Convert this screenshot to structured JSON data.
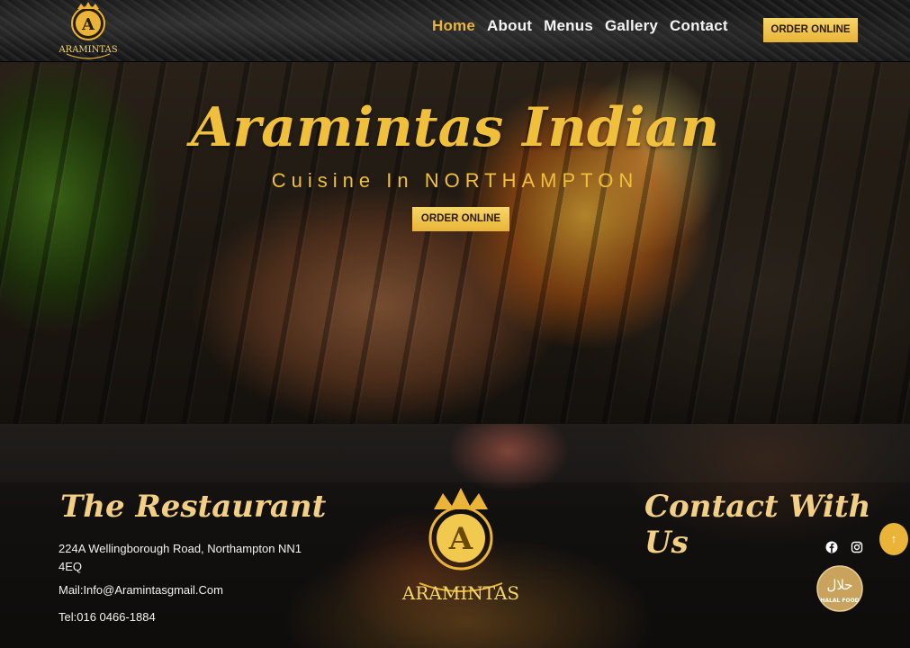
{
  "header": {
    "logo_text": "ARAMINTAS",
    "logo_letter": "A",
    "nav": [
      {
        "label": "Home",
        "active": true
      },
      {
        "label": "About",
        "active": false
      },
      {
        "label": "Menus",
        "active": false
      },
      {
        "label": "Gallery",
        "active": false
      },
      {
        "label": "Contact",
        "active": false
      }
    ],
    "order_button": "ORDER ONLINE"
  },
  "hero": {
    "title": "Aramintas Indian",
    "subtitle": "Cuisine In NORTHAMPTON",
    "order_button": "ORDER ONLINE"
  },
  "footer": {
    "restaurant_title": "The Restaurant",
    "address": "224A Wellingborough Road, Northampton NN1 4EQ",
    "mail": "Mail:Info@Aramintasgmail.Com",
    "tel": "Tel:016 0466-1884",
    "logo_text": "ARAMINTAS",
    "logo_letter": "A",
    "contact_title": "Contact With Us",
    "social": [
      "facebook-icon",
      "instagram-icon"
    ],
    "halal_badge": {
      "arabic": "حلال",
      "label": "HALAL FOOD"
    },
    "scroll_top_icon": "arrow-up-icon",
    "scroll_top_glyph": "↑"
  },
  "colors": {
    "accent_gold": "#e9b437",
    "title_gold": "#f0bf3c",
    "footer_heading": "#f3cf86",
    "text_light": "#f2f2f2"
  }
}
